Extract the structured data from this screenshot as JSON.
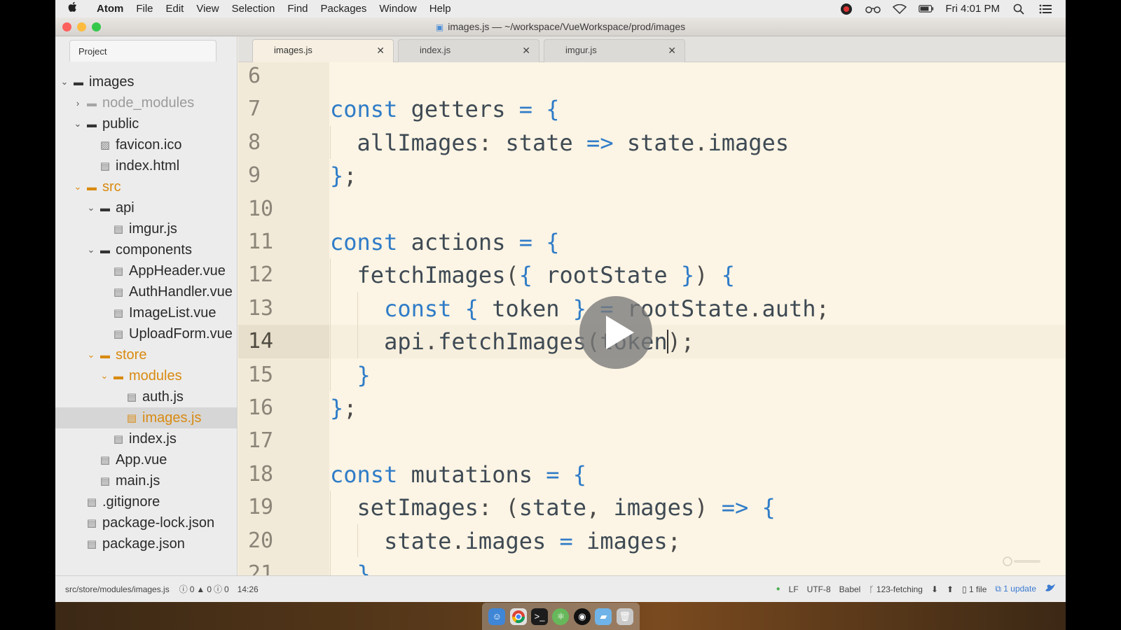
{
  "menubar": {
    "apple": "",
    "items": [
      "Atom",
      "File",
      "Edit",
      "View",
      "Selection",
      "Find",
      "Packages",
      "Window",
      "Help"
    ],
    "clock": "Fri 4:01 PM"
  },
  "window": {
    "title": "images.js — ~/workspace/VueWorkspace/prod/images"
  },
  "tree": {
    "tab_label": "Project",
    "items": [
      {
        "label": "images",
        "kind": "folder",
        "depth": 0,
        "expanded": true
      },
      {
        "label": "node_modules",
        "kind": "folder",
        "depth": 1,
        "expanded": false,
        "muted": true
      },
      {
        "label": "public",
        "kind": "folder",
        "depth": 1,
        "expanded": true
      },
      {
        "label": "favicon.ico",
        "kind": "image",
        "depth": 2
      },
      {
        "label": "index.html",
        "kind": "file",
        "depth": 2
      },
      {
        "label": "src",
        "kind": "folder",
        "depth": 1,
        "expanded": true,
        "status": "modified"
      },
      {
        "label": "api",
        "kind": "folder",
        "depth": 2,
        "expanded": true
      },
      {
        "label": "imgur.js",
        "kind": "file",
        "depth": 3
      },
      {
        "label": "components",
        "kind": "folder",
        "depth": 2,
        "expanded": true
      },
      {
        "label": "AppHeader.vue",
        "kind": "file",
        "depth": 3
      },
      {
        "label": "AuthHandler.vue",
        "kind": "file",
        "depth": 3
      },
      {
        "label": "ImageList.vue",
        "kind": "file",
        "depth": 3
      },
      {
        "label": "UploadForm.vue",
        "kind": "file",
        "depth": 3
      },
      {
        "label": "store",
        "kind": "folder",
        "depth": 2,
        "expanded": true,
        "status": "modified"
      },
      {
        "label": "modules",
        "kind": "folder",
        "depth": 3,
        "expanded": true,
        "status": "modified"
      },
      {
        "label": "auth.js",
        "kind": "file",
        "depth": 4
      },
      {
        "label": "images.js",
        "kind": "file",
        "depth": 4,
        "selected": true,
        "status": "modified"
      },
      {
        "label": "index.js",
        "kind": "file",
        "depth": 3
      },
      {
        "label": "App.vue",
        "kind": "file",
        "depth": 2
      },
      {
        "label": "main.js",
        "kind": "file",
        "depth": 2
      },
      {
        "label": ".gitignore",
        "kind": "file",
        "depth": 1
      },
      {
        "label": "package-lock.json",
        "kind": "file",
        "depth": 1
      },
      {
        "label": "package.json",
        "kind": "file",
        "depth": 1
      }
    ]
  },
  "tabs": [
    {
      "label": "images.js",
      "active": true
    },
    {
      "label": "index.js",
      "active": false
    },
    {
      "label": "imgur.js",
      "active": false
    }
  ],
  "editor": {
    "current_line": 14,
    "lines": [
      {
        "n": "6",
        "text": ""
      },
      {
        "n": "7",
        "text": "const getters = {"
      },
      {
        "n": "8",
        "text": "  allImages: state => state.images"
      },
      {
        "n": "9",
        "text": "};"
      },
      {
        "n": "10",
        "text": ""
      },
      {
        "n": "11",
        "text": "const actions = {"
      },
      {
        "n": "12",
        "text": "  fetchImages({ rootState }) {"
      },
      {
        "n": "13",
        "text": "    const { token } = rootState.auth;"
      },
      {
        "n": "14",
        "text": "    api.fetchImages(token);"
      },
      {
        "n": "15",
        "text": "  }"
      },
      {
        "n": "16",
        "text": "};"
      },
      {
        "n": "17",
        "text": ""
      },
      {
        "n": "18",
        "text": "const mutations = {"
      },
      {
        "n": "19",
        "text": "  setImages: (state, images) => {"
      },
      {
        "n": "20",
        "text": "    state.images = images;"
      },
      {
        "n": "21",
        "text": "  }"
      }
    ]
  },
  "status": {
    "path": "src/store/modules/images.js",
    "errors": "0",
    "warnings": "0",
    "infos": "0",
    "position": "14:26",
    "line_ending": "LF",
    "encoding": "UTF-8",
    "grammar": "Babel",
    "branch": "123-fetching",
    "git_files": "1 file",
    "updates": "1 update"
  },
  "colors": {
    "keyword": "#2f7cc8",
    "modified": "#d98a10",
    "editor_bg": "#fcf4e4"
  }
}
